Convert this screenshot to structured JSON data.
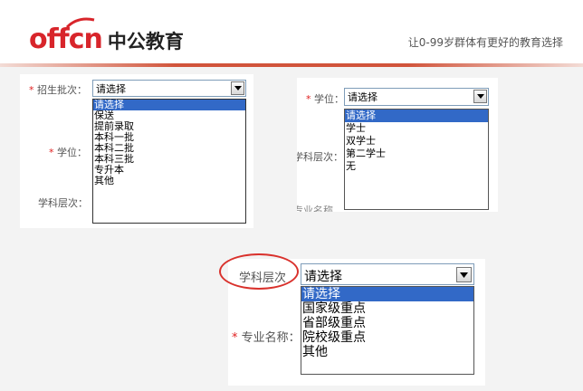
{
  "header": {
    "logo_en": "offcn",
    "logo_cn": "中公教育",
    "slogan": "让0-99岁群体有更好的教育选择"
  },
  "panel_left": {
    "batch_label": "招生批次：",
    "degree_label": "学位：",
    "level_label": "学科层次：",
    "required_mark": "*",
    "select_value": "请选择",
    "options": [
      "请选择",
      "保送",
      "提前录取",
      "本科一批",
      "本科二批",
      "本科三批",
      "专升本",
      "其他"
    ],
    "selected_index": 0
  },
  "panel_right": {
    "degree_label": "学位：",
    "level_label": "学科层次：",
    "major_label_partial": "专业名称",
    "required_mark": "*",
    "select_value": "请选择",
    "options": [
      "请选择",
      "学士",
      "双学士",
      "第二学士",
      "无"
    ],
    "selected_index": 0
  },
  "panel_bottom": {
    "level_label": "学科层次",
    "major_label": "专业名称：",
    "required_mark": "*",
    "select_value": "请选择",
    "options": [
      "请选择",
      "国家级重点",
      "省部级重点",
      "院校级重点",
      "其他"
    ],
    "selected_index": 0
  },
  "colors": {
    "brand_red": "#d8252b",
    "selection_blue": "#3269c7",
    "annotation_red": "#d9312c"
  },
  "icons": {
    "dropdown": "chevron-down-icon"
  }
}
